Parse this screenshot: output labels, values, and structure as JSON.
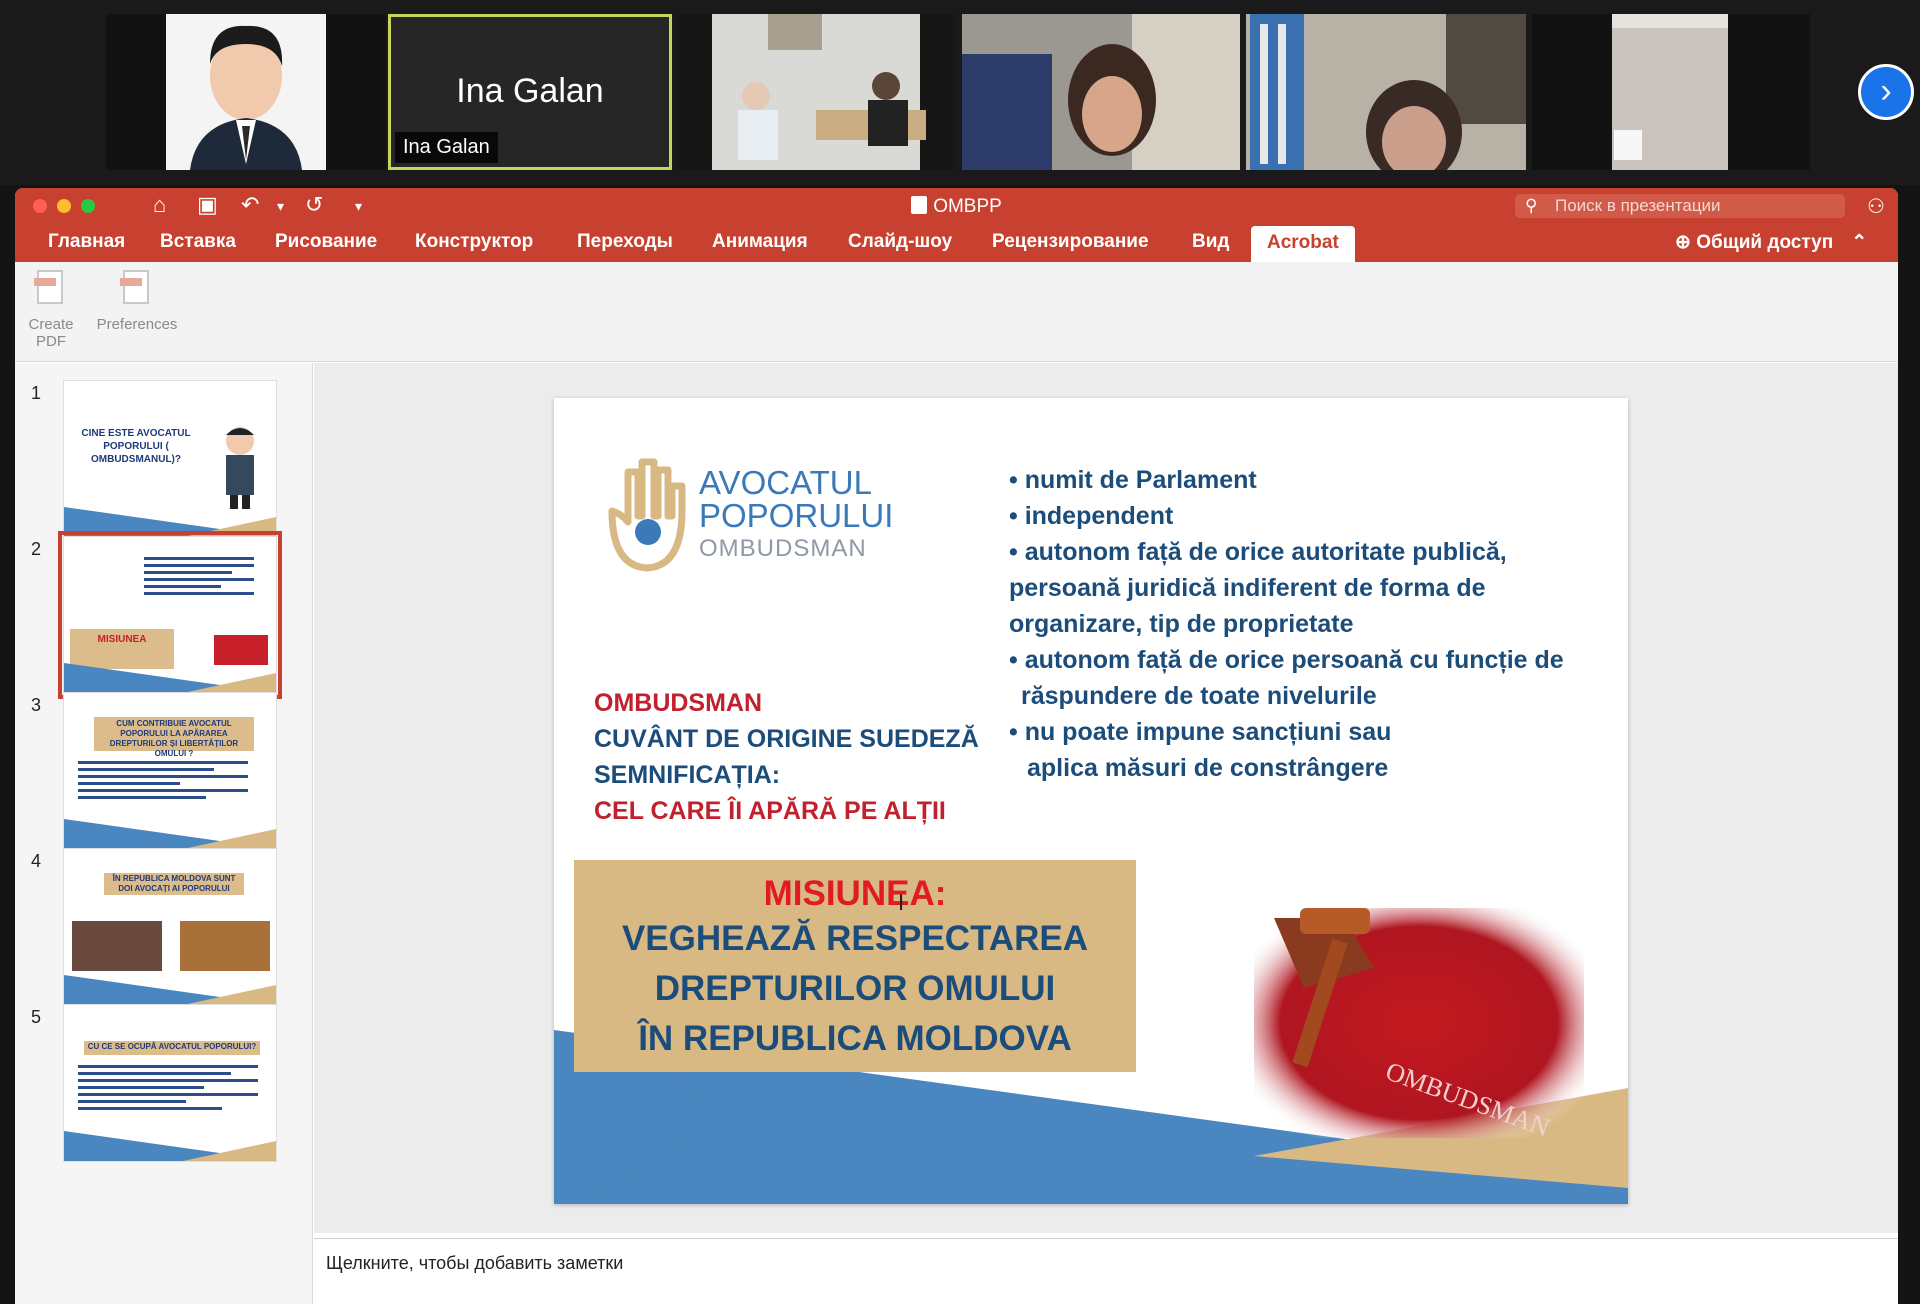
{
  "participants": [
    {
      "id": "p1",
      "name": ""
    },
    {
      "id": "p2",
      "name": "Ina Galan",
      "tag": "Ina Galan"
    },
    {
      "id": "p3",
      "name": ""
    },
    {
      "id": "p4",
      "name": ""
    },
    {
      "id": "p5",
      "name": ""
    },
    {
      "id": "p6",
      "name": ""
    }
  ],
  "app": {
    "title": "OMBPP",
    "search_placeholder": "Поиск в презентации",
    "share_label": "Общий доступ",
    "tabs": [
      "Главная",
      "Вставка",
      "Рисование",
      "Конструктор",
      "Переходы",
      "Анимация",
      "Слайд-шоу",
      "Рецензирование",
      "Вид",
      "Acrobat"
    ],
    "active_tab": "Acrobat",
    "tools": [
      {
        "label_line1": "Create",
        "label_line2": "PDF"
      },
      {
        "label_line1": "Preferences",
        "label_line2": ""
      }
    ],
    "notes_placeholder": "Щелкните, чтобы добавить заметки"
  },
  "thumbnails": [
    {
      "number": "1",
      "title": "CINE ESTE AVOCATUL POPORULUI ( OMBUDSMANUL)?"
    },
    {
      "number": "2",
      "title": "MISIUNEA"
    },
    {
      "number": "3",
      "title": "CUM CONTRIBUIE AVOCATUL POPORULUI LA APĂRAREA DREPTURILOR ȘI LIBERTĂȚILOR OMULUI ?"
    },
    {
      "number": "4",
      "title": "ÎN REPUBLICA MOLDOVA SUNT DOI AVOCAȚI AI POPORULUI"
    },
    {
      "number": "5",
      "title": "CU CE SE OCUPĂ AVOCATUL POPORULUI?"
    }
  ],
  "selected_slide": 2,
  "slide": {
    "logo_line1": "AVOCATUL",
    "logo_line2": "POPORULUI",
    "logo_line3": "OMBUDSMAN",
    "bullets": [
      "• numit de Parlament",
      "• independent",
      "• autonom față de orice autoritate  publică,",
      "persoană juridică indiferent de forma de",
      "organizare, tip de proprietate",
      "• autonom față de orice persoană cu funcție de",
      "  răspundere de toate nivelurile",
      "• nu poate impune sancțiuni sau",
      "  aplica măsuri de constrângere"
    ],
    "omb_line1": "OMBUDSMAN",
    "omb_line2": "CUVÂNT DE ORIGINE SUEDEZĂ",
    "omb_line3": "SEMNIFICAȚIA:",
    "omb_line4": "CEL CARE ÎI APĂRĂ PE ALȚII",
    "mission_heading": "MISIUNEA:",
    "mission_line1": "VEGHEAZĂ RESPECTAREA",
    "mission_line2": "DREPTURILOR OMULUI",
    "mission_line3": "ÎN REPUBLICA MOLDOVA",
    "book_label": "OMBUDSMAN"
  },
  "colors": {
    "ppt_red": "#c8402f",
    "slide_blue": "#4a86bf",
    "slide_gold": "#d9b983",
    "text_navy": "#1c4d7a",
    "text_red": "#c2202d"
  }
}
